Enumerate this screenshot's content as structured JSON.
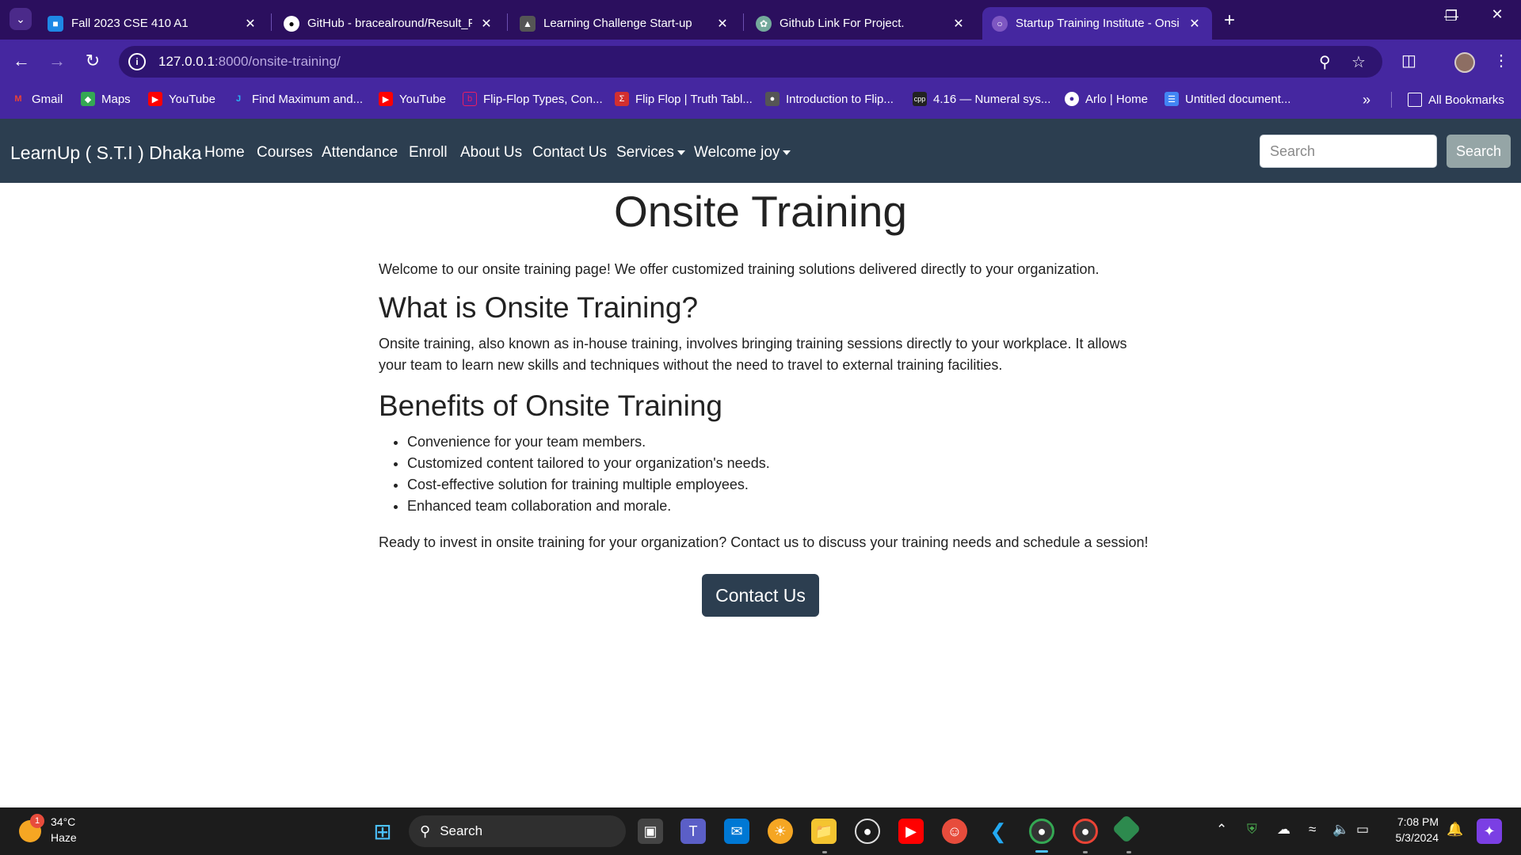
{
  "browser": {
    "tabs": [
      {
        "title": "Fall 2023 CSE 410 A1",
        "favicon": "classroom-icon",
        "color": "#1e88e5"
      },
      {
        "title": "GitHub - bracealround/Result_P",
        "favicon": "github-icon",
        "color": "#ffffff"
      },
      {
        "title": "Learning Challenge Start-up",
        "favicon": "learning-icon",
        "color": "#ffffff"
      },
      {
        "title": "Github Link For Project.",
        "favicon": "chatgpt-icon",
        "color": "#ffffff"
      },
      {
        "title": "Startup Training Institute - Onsi",
        "favicon": "globe-icon",
        "color": "#ffffff"
      }
    ],
    "url_host": "127.0.0.1",
    "url_path": ":8000/onsite-training/",
    "bookmarks": [
      {
        "label": "Gmail",
        "icon": "gmail-icon",
        "color": "#ea4335"
      },
      {
        "label": "Maps",
        "icon": "maps-icon",
        "color": "#34a853"
      },
      {
        "label": "YouTube",
        "icon": "youtube-icon",
        "color": "#ff0000"
      },
      {
        "label": "Find Maximum and...",
        "icon": "j-icon",
        "color": "#29b6f6"
      },
      {
        "label": "YouTube",
        "icon": "youtube-icon",
        "color": "#ff0000"
      },
      {
        "label": "Flip-Flop Types, Con...",
        "icon": "flipflop-icon",
        "color": "#e91e63"
      },
      {
        "label": "Flip Flop | Truth Tabl...",
        "icon": "sigma-icon",
        "color": "#d32f2f"
      },
      {
        "label": "Introduction to Flip...",
        "icon": "shield-icon",
        "color": "#555555"
      },
      {
        "label": "4.16 — Numeral sys...",
        "icon": "cpp-icon",
        "color": "#222222"
      },
      {
        "label": "Arlo | Home",
        "icon": "arlo-icon",
        "color": "#ffffff"
      },
      {
        "label": "Untitled document...",
        "icon": "docs-icon",
        "color": "#4285f4"
      }
    ],
    "all_bookmarks": "All Bookmarks"
  },
  "site": {
    "brand": "LearnUp ( S.T.I ) Dhaka",
    "nav": [
      "Home",
      "Courses",
      "Attendance",
      "Enroll",
      "About Us",
      "Contact Us"
    ],
    "services": "Services",
    "welcome": "Welcome joy",
    "search_placeholder": "Search",
    "search_button": "Search"
  },
  "page": {
    "title": "Onsite Training",
    "intro": "Welcome to our onsite training page! We offer customized training solutions delivered directly to your organization.",
    "what_heading": "What is Onsite Training?",
    "what_body": "Onsite training, also known as in-house training, involves bringing training sessions directly to your workplace. It allows your team to learn new skills and techniques without the need to travel to external training facilities.",
    "benefits_heading": "Benefits of Onsite Training",
    "benefits": [
      "Convenience for your team members.",
      "Customized content tailored to your organization's needs.",
      "Cost-effective solution for training multiple employees.",
      "Enhanced team collaboration and morale."
    ],
    "closing": "Ready to invest in onsite training for your organization? Contact us to discuss your training needs and schedule a session!",
    "cta": "Contact Us"
  },
  "taskbar": {
    "weather_temp": "34°C",
    "weather_desc": "Haze",
    "weather_badge": "1",
    "search": "Search",
    "time": "7:08 PM",
    "date": "5/3/2024"
  },
  "colors": {
    "tab_strip": "#2b0f5e",
    "toolbar": "#4527a0",
    "site_nav": "#2c3e50",
    "search_button": "#95a5a6"
  }
}
